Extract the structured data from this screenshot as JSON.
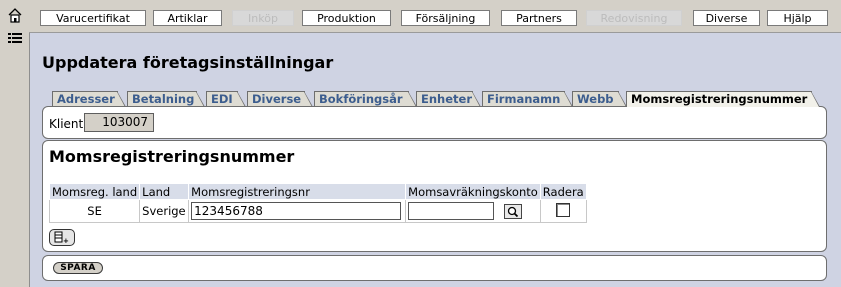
{
  "nav": {
    "items": [
      {
        "label": "Varucertifikat",
        "enabled": true
      },
      {
        "label": "Artiklar",
        "enabled": true
      },
      {
        "label": "Inköp",
        "enabled": false
      },
      {
        "label": "Produktion",
        "enabled": true
      },
      {
        "label": "Försäljning",
        "enabled": true
      },
      {
        "label": "Partners",
        "enabled": true
      },
      {
        "label": "Redovisning",
        "enabled": false
      },
      {
        "label": "Diverse",
        "enabled": true
      },
      {
        "label": "Hjälp",
        "enabled": true
      }
    ]
  },
  "page": {
    "title": "Uppdatera företagsinställningar"
  },
  "tabs": [
    {
      "label": "Adresser"
    },
    {
      "label": "Betalning"
    },
    {
      "label": "EDI"
    },
    {
      "label": "Diverse"
    },
    {
      "label": "Bokföringsår"
    },
    {
      "label": "Enheter"
    },
    {
      "label": "Firmanamn"
    },
    {
      "label": "Webb"
    },
    {
      "label": "Momsregistreringsnummer",
      "active": true
    }
  ],
  "client": {
    "label": "Klient",
    "value": "103007"
  },
  "section": {
    "title": "Momsregistreringsnummer",
    "columns": [
      "Momsreg. land",
      "Land",
      "Momsregistreringsnr",
      "Momsavräkningskonto",
      "Radera"
    ],
    "row": {
      "land_code": "SE",
      "land": "Sverige",
      "momsreg_nr": "123456788",
      "momsavrakningskonto": "",
      "radera": false
    }
  },
  "buttons": {
    "save_label": "SPARA"
  },
  "colors": {
    "content_bg": "#cfd3e3",
    "tab_text": "#3c5d8e",
    "header_bg": "#d8dde9"
  },
  "icons": {
    "home": "home-icon",
    "menu": "menu-list-icon",
    "add_row": "add-row-icon",
    "search": "search-icon"
  }
}
